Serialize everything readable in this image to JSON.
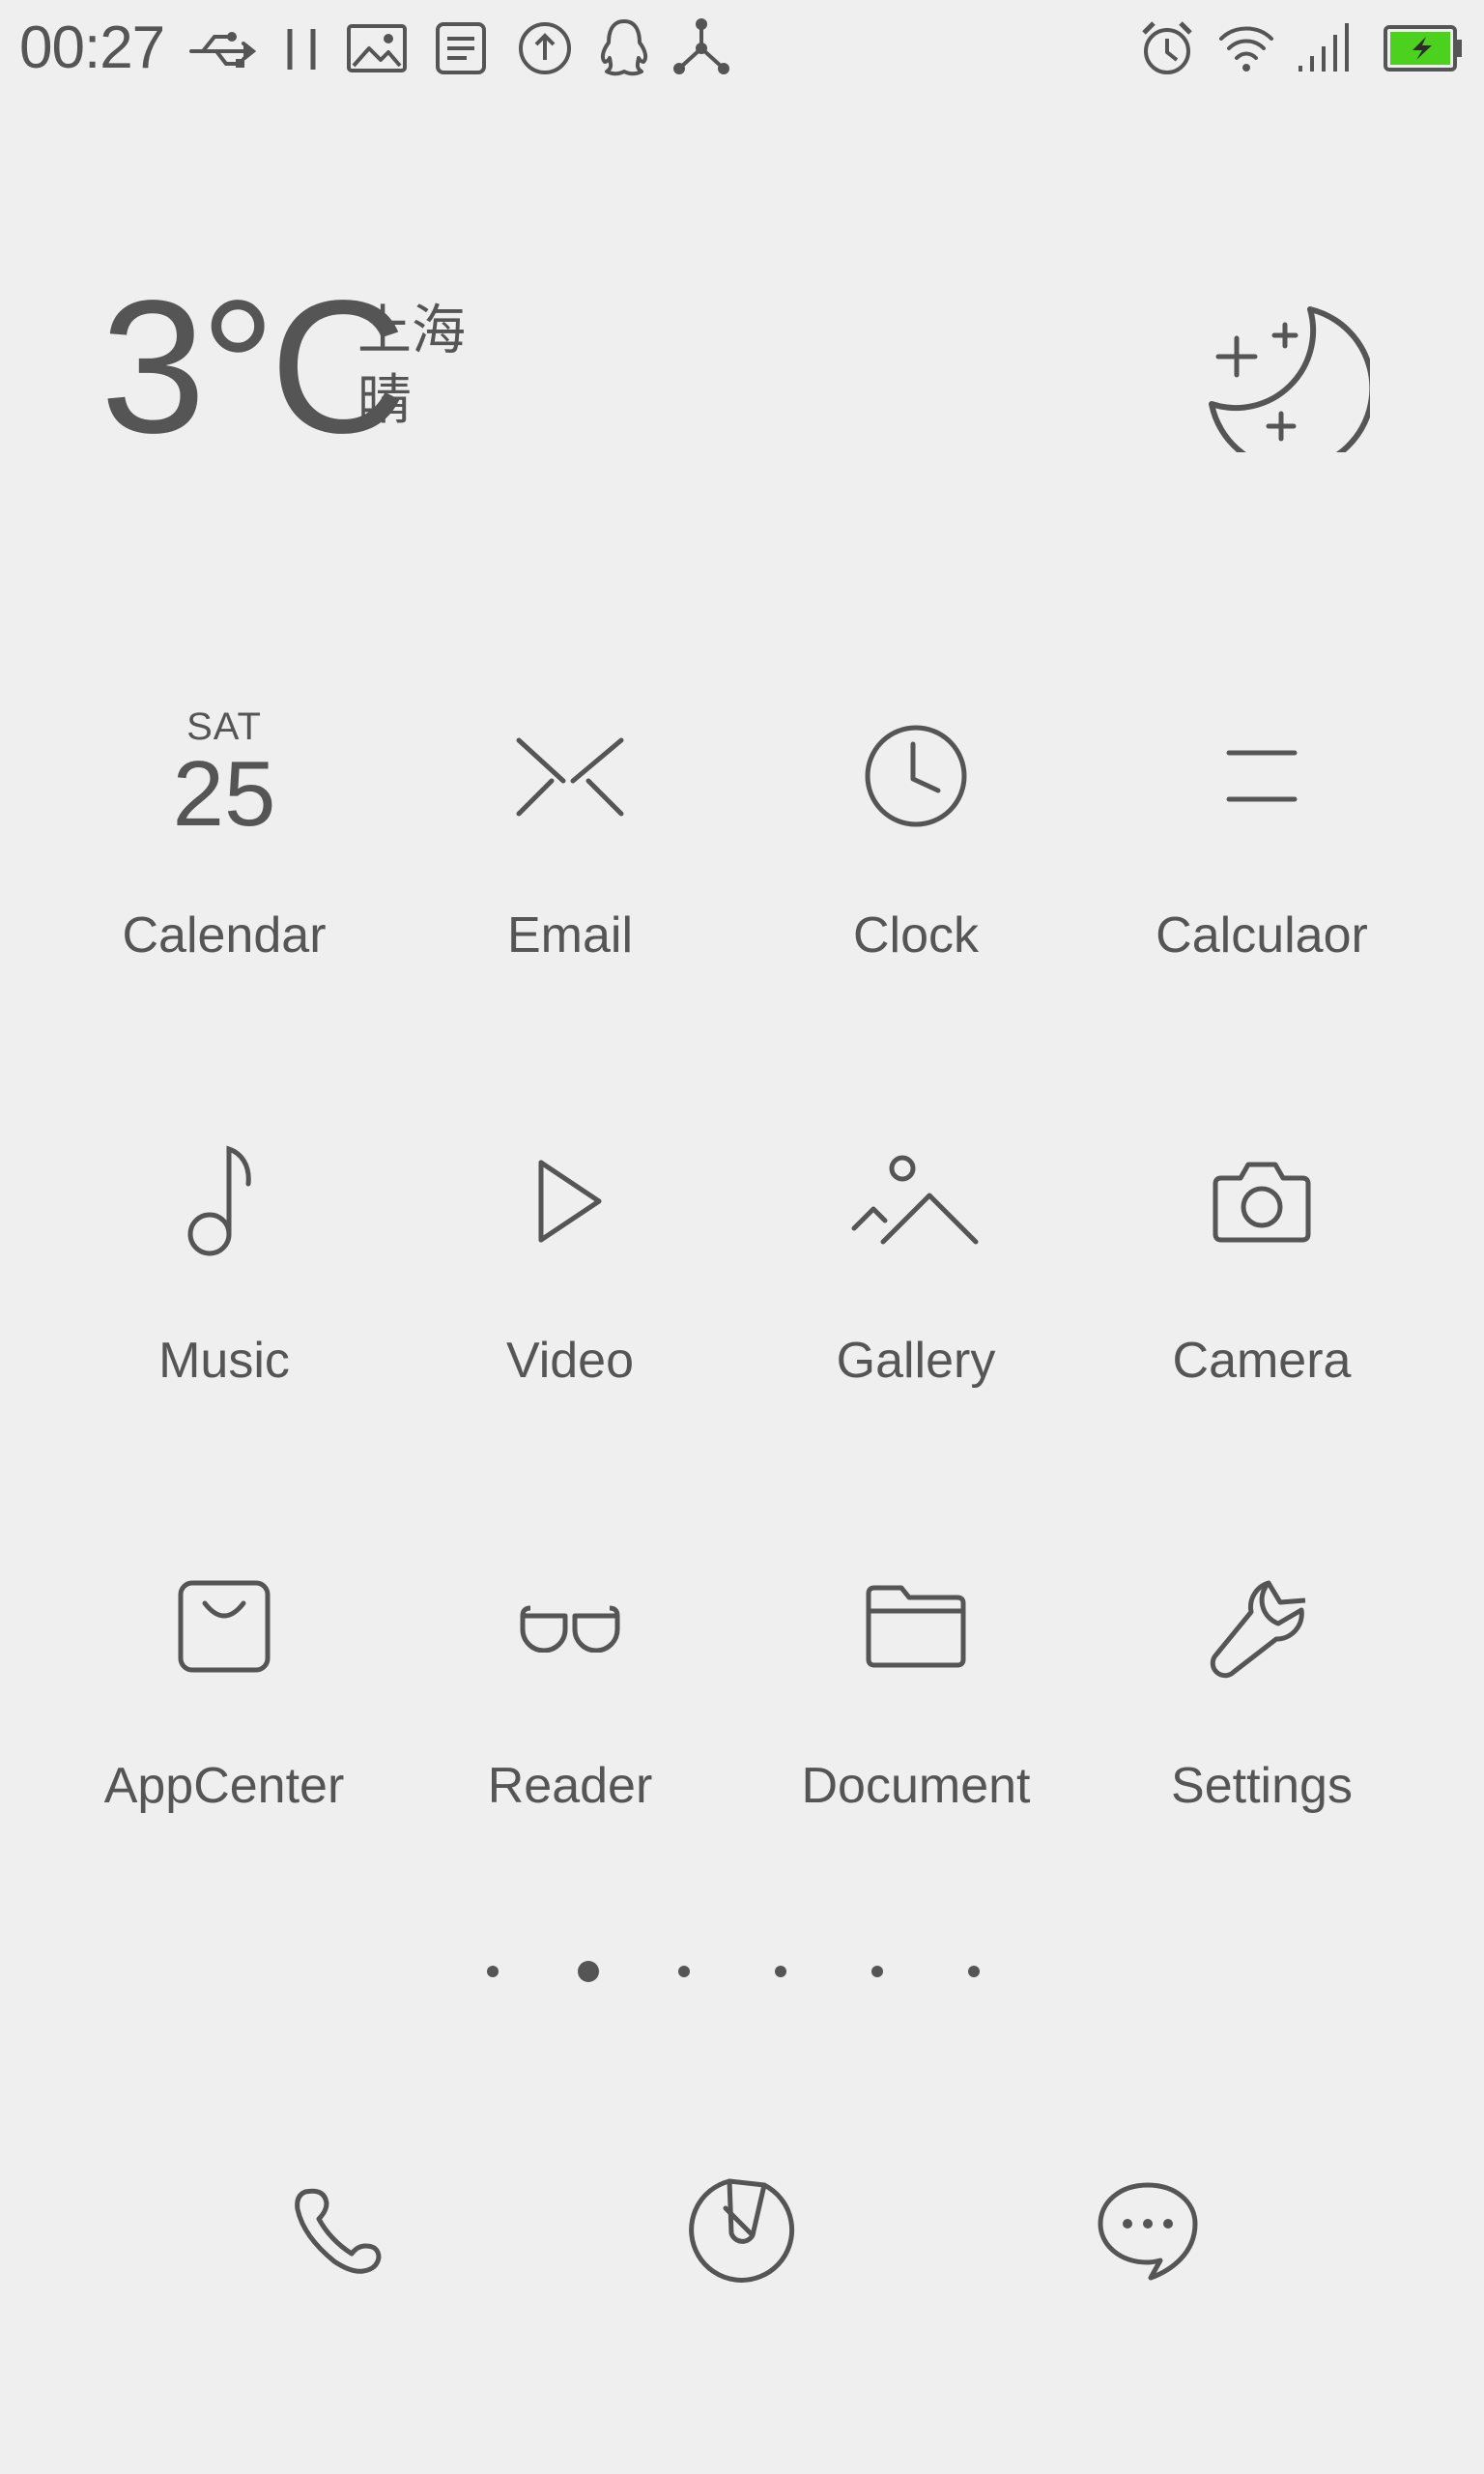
{
  "status_bar": {
    "time": "00:27",
    "left_icons": [
      "usb-icon",
      "pause-icon",
      "image-icon",
      "note-icon",
      "upload-icon",
      "qq-icon",
      "share-hub-icon"
    ],
    "right_icons": [
      "alarm-icon",
      "wifi-icon",
      "signal-icon",
      "battery-charging-icon"
    ],
    "battery_color": "#4cd11e"
  },
  "weather": {
    "temperature": "3°C",
    "city": "上海",
    "condition": "晴",
    "icon": "moon-stars-icon"
  },
  "apps": [
    {
      "label": "Calendar",
      "icon": "calendar-icon",
      "day": "SAT",
      "date": "25"
    },
    {
      "label": "Email",
      "icon": "email-icon"
    },
    {
      "label": "Clock",
      "icon": "clock-icon"
    },
    {
      "label": "Calculaor",
      "icon": "calculator-icon"
    },
    {
      "label": "Music",
      "icon": "music-note-icon"
    },
    {
      "label": "Video",
      "icon": "play-icon"
    },
    {
      "label": "Gallery",
      "icon": "mountain-icon"
    },
    {
      "label": "Camera",
      "icon": "camera-icon"
    },
    {
      "label": "AppCenter",
      "icon": "shopping-bag-icon"
    },
    {
      "label": "Reader",
      "icon": "glasses-icon"
    },
    {
      "label": "Document",
      "icon": "folder-icon"
    },
    {
      "label": "Settings",
      "icon": "wrench-icon"
    }
  ],
  "page_indicator": {
    "count": 6,
    "active_index": 1
  },
  "dock": [
    {
      "icon": "phone-icon"
    },
    {
      "icon": "browser-compass-icon"
    },
    {
      "icon": "message-bubble-icon"
    }
  ],
  "colors": {
    "background": "#efefef",
    "foreground": "#555555"
  }
}
